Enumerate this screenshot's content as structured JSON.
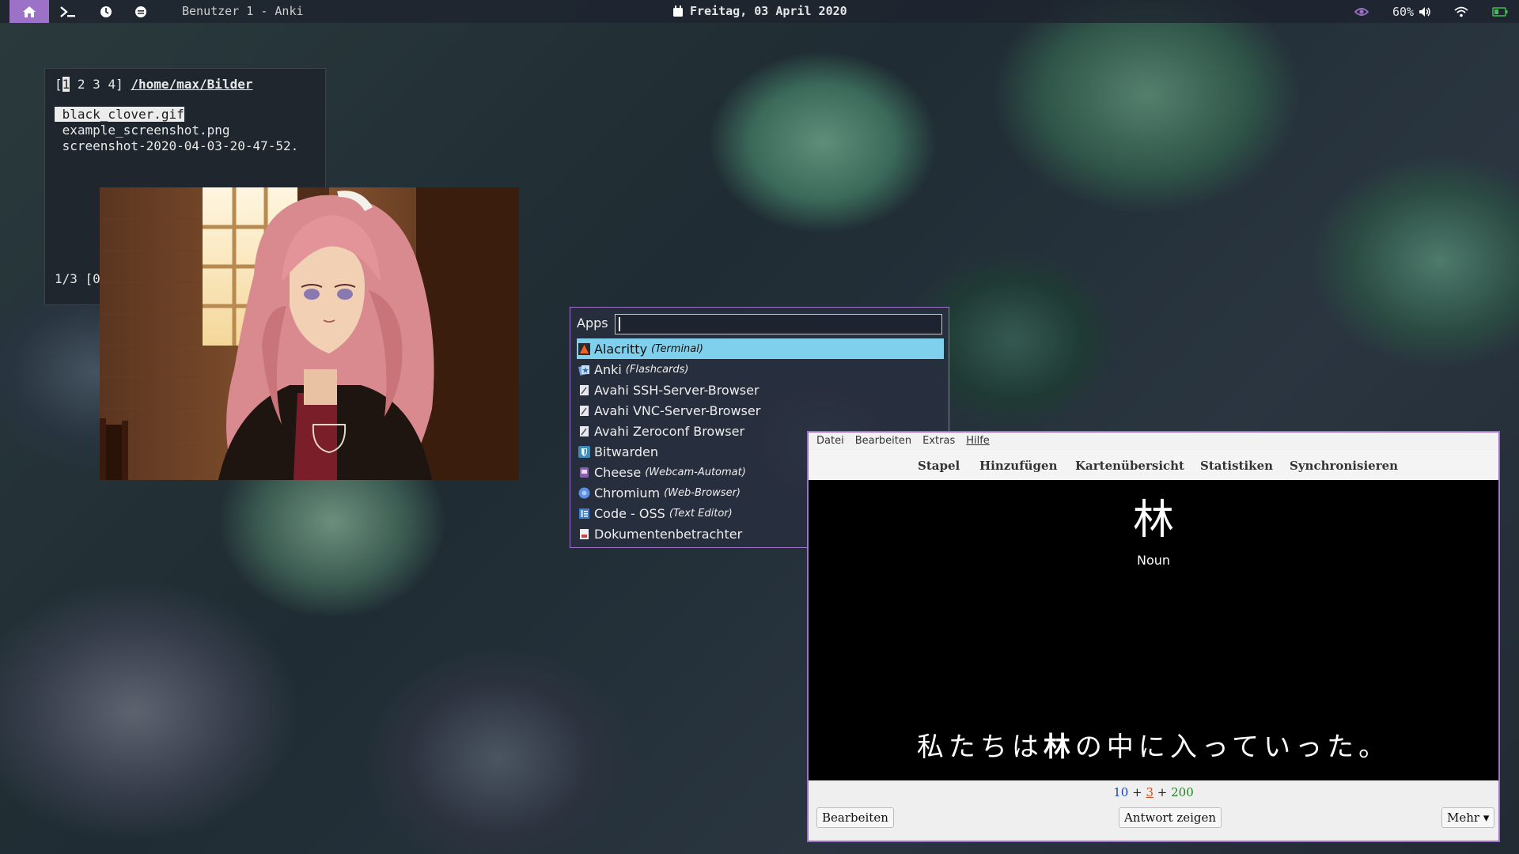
{
  "topbar": {
    "window_title": "Benutzer 1 - Anki",
    "date": "Freitag, 03 April 2020",
    "volume": "60%",
    "workspaces": [
      "home-icon",
      "terminal-icon",
      "clock-icon",
      "chat-icon"
    ],
    "active_color": "#9c72c9"
  },
  "terminal": {
    "tab_prefix": "[",
    "tab_current": "1",
    "tab_rest": " 2 3 4] ",
    "path": "/home/max/Bilder",
    "files": [
      " black_clover.gif",
      " example_screenshot.png",
      " screenshot-2020-04-03-20-47-52."
    ],
    "status": "1/3 [0"
  },
  "launcher": {
    "prompt": "Apps",
    "input_value": "",
    "selected_color": "#7fd0ec",
    "items": [
      {
        "name": "Alacritty",
        "desc": "(Terminal)",
        "icon": "alacritty-icon"
      },
      {
        "name": "Anki",
        "desc": "(Flashcards)",
        "icon": "anki-icon"
      },
      {
        "name": "Avahi SSH-Server-Browser",
        "desc": "",
        "icon": "avahi-icon"
      },
      {
        "name": "Avahi VNC-Server-Browser",
        "desc": "",
        "icon": "avahi-icon"
      },
      {
        "name": "Avahi Zeroconf Browser",
        "desc": "",
        "icon": "avahi-icon"
      },
      {
        "name": "Bitwarden",
        "desc": "",
        "icon": "bitwarden-icon"
      },
      {
        "name": "Cheese",
        "desc": "(Webcam-Automat)",
        "icon": "cheese-icon"
      },
      {
        "name": "Chromium",
        "desc": "(Web-Browser)",
        "icon": "chromium-icon"
      },
      {
        "name": "Code - OSS",
        "desc": "(Text Editor)",
        "icon": "code-icon"
      },
      {
        "name": "Dokumentenbetrachter",
        "desc": "",
        "icon": "document-viewer-icon"
      }
    ]
  },
  "anki": {
    "menu": [
      "Datei",
      "Bearbeiten",
      "Extras",
      "Hilfe"
    ],
    "toolbar": [
      "Stapel",
      "Hinzufügen",
      "Kartenübersicht",
      "Statistiken",
      "Synchronisieren"
    ],
    "card": {
      "kanji": "林",
      "part_of_speech": "Noun",
      "sentence_before": "私たちは",
      "sentence_highlight": "林",
      "sentence_after": "の中に入っていった。"
    },
    "counts": {
      "new": "10",
      "new_color": "#1f3fb5",
      "learning": "3",
      "learning_color": "#c8501e",
      "review": "200",
      "review_color": "#1a8a1a",
      "plus": "+"
    },
    "buttons": {
      "edit": "Bearbeiten",
      "show_answer": "Antwort zeigen",
      "more": "Mehr ▾"
    }
  }
}
